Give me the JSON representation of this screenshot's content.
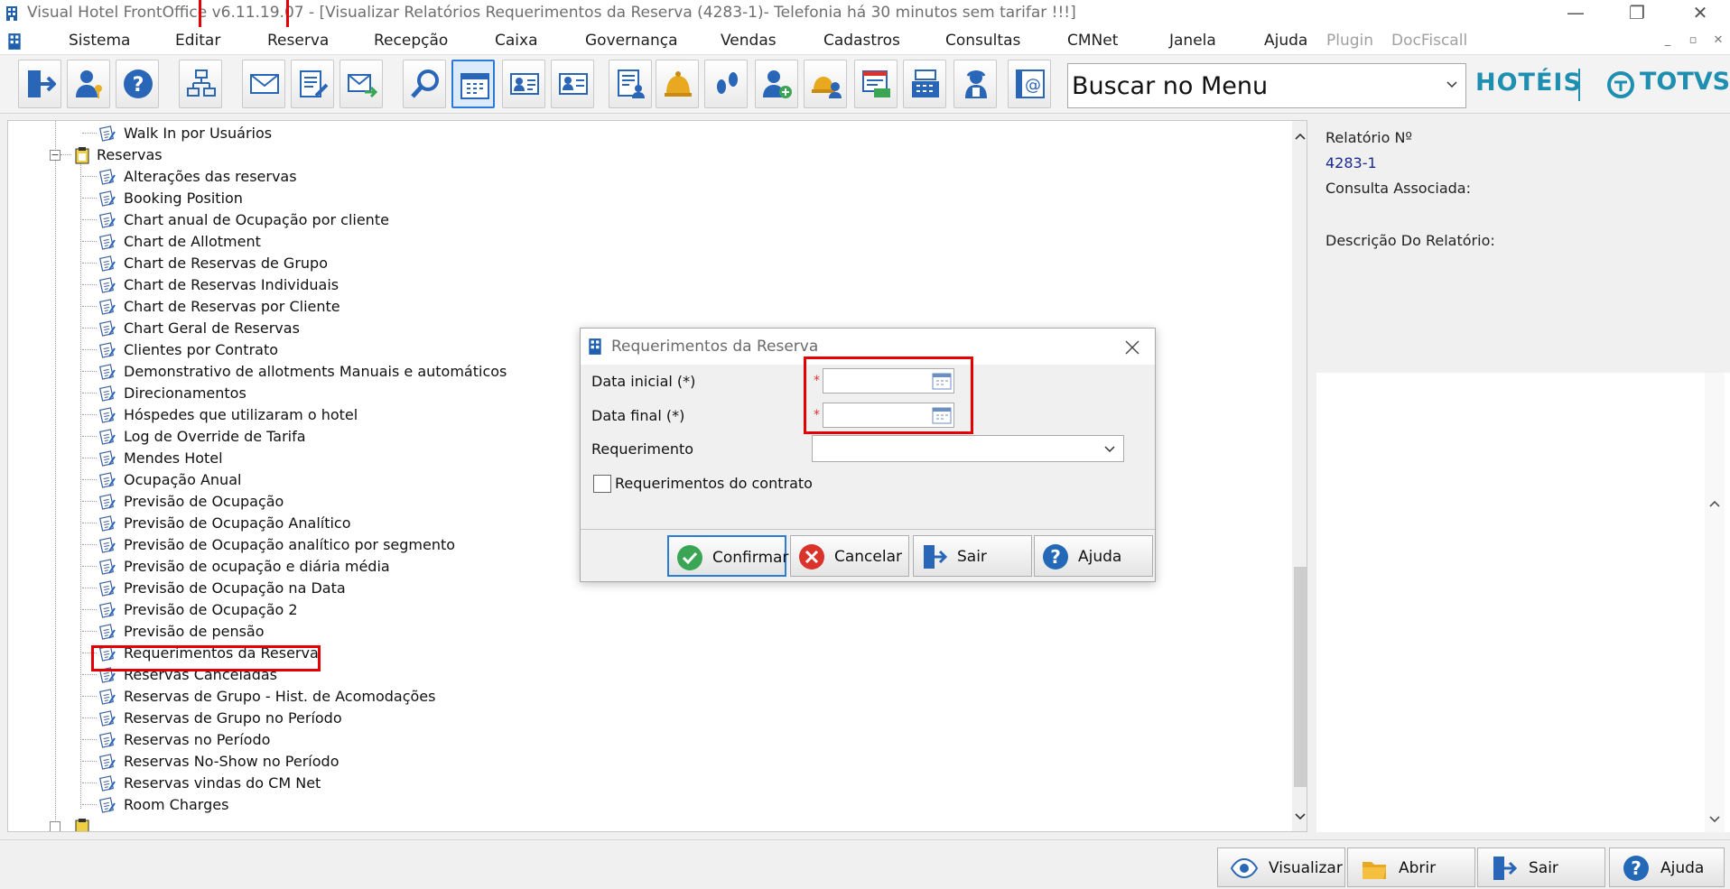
{
  "window": {
    "title": "Visual Hotel FrontOffice v6.11.19.07 - [Visualizar Relatórios Requerimentos da Reserva (4283-1)- Telefonia há 30 minutos sem tarifar !!!]",
    "minimize": "—",
    "restore": "❐",
    "close": "✕"
  },
  "menu": {
    "items": [
      "Sistema",
      "Editar",
      "Reserva",
      "Recepção",
      "Caixa",
      "Governança",
      "Vendas",
      "Cadastros",
      "Consultas",
      "CMNet",
      "Janela",
      "Ajuda",
      "Plugin",
      "DocFiscall"
    ],
    "mdi_min": "_",
    "mdi_restore": "▫",
    "mdi_close": "✕"
  },
  "toolbar": {
    "search_value": "Buscar no Menu",
    "brand_hoteis": "HOTÉIS",
    "brand_totvs": "TOTVS",
    "icons": [
      "exit-icon",
      "user-key-icon",
      "help-icon",
      "org-chart-icon",
      "mail-icon",
      "edit-report-icon",
      "send-mail-icon",
      "search-icon",
      "calendar-icon",
      "guest-card-icon",
      "reservation-card-icon",
      "report-user-icon",
      "bell-icon",
      "footprint-icon",
      "add-user-icon",
      "concierge-icon",
      "cash-report-icon",
      "cash-register-icon",
      "maid-icon",
      "contact-email-icon"
    ],
    "active_index": 8
  },
  "tree": {
    "top_item": "Walk In por Usuários",
    "group": "Reservas",
    "items": [
      "Alterações das reservas",
      "Booking Position",
      "Chart anual de Ocupação por cliente",
      "Chart de Allotment",
      "Chart de Reservas de Grupo",
      "Chart de Reservas Individuais",
      "Chart de Reservas por Cliente",
      "Chart Geral de Reservas",
      "Clientes por Contrato",
      "Demonstrativo de allotments Manuais e automáticos",
      "Direcionamentos",
      "Hóspedes que utilizaram o hotel",
      "Log de Override de Tarifa",
      "Mendes Hotel",
      "Ocupação Anual",
      "Previsão de Ocupação",
      "Previsão de Ocupação Analítico",
      "Previsão de Ocupação analítico por segmento",
      "Previsão de ocupação e diária média",
      "Previsão de Ocupação na Data",
      "Previsão de Ocupação 2",
      "Previsão de pensão",
      "Requerimentos da Reserva",
      "Reservas Canceladas",
      "Reservas de Grupo - Hist. de Acomodações",
      "Reservas de Grupo no Período",
      "Reservas no Período",
      "Reservas No-Show no Período",
      "Reservas vindas do CM Net",
      "Room Charges"
    ],
    "selected_index": 22
  },
  "report_info": {
    "number_label": "Relatório Nº",
    "number_value": "4283-1",
    "query_label": "Consulta Associada:",
    "description_label": "Descrição Do Relatório:"
  },
  "dialog": {
    "title": "Requerimentos da Reserva",
    "start_date_label": "Data inicial (*)",
    "end_date_label": "Data final (*)",
    "start_date_value": "",
    "end_date_value": "",
    "required_mark": "*",
    "requirement_label": "Requerimento",
    "requirement_value": "",
    "contract_checkbox_label": "Requerimentos do contrato",
    "contract_checked": false,
    "buttons": {
      "confirm": "Confirmar",
      "cancel": "Cancelar",
      "exit": "Sair",
      "help": "Ajuda"
    }
  },
  "bottom": {
    "view": "Visualizar",
    "open": "Abrir",
    "exit": "Sair",
    "help": "Ajuda"
  },
  "colors": {
    "accent_blue": "#2b7bd8",
    "brand": "#1e8fb0",
    "highlight_red": "#e40000",
    "confirm_green": "#3aa655",
    "cancel_red": "#d9332b",
    "help_blue": "#2468b8"
  }
}
